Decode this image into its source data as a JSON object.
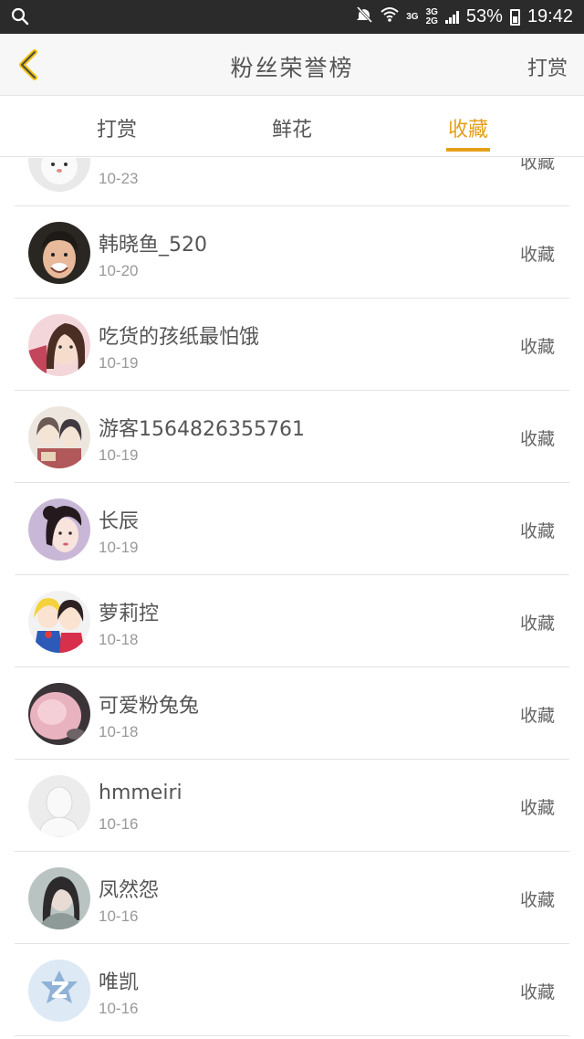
{
  "status_bar": {
    "network_top": "3G",
    "network_mid": "3G",
    "network_bottom": "2G",
    "battery": "53%",
    "time": "19:42"
  },
  "header": {
    "title": "粉丝荣誉榜",
    "action": "打赏"
  },
  "tabs": [
    {
      "label": "打赏",
      "active": false
    },
    {
      "label": "鲜花",
      "active": false
    },
    {
      "label": "收藏",
      "active": true
    }
  ],
  "accent_color": "#e5a019",
  "fans": [
    {
      "name": "",
      "date": "10-23",
      "action": "收藏",
      "avatar": "white-bunny"
    },
    {
      "name": "韩晓鱼_520",
      "date": "10-20",
      "action": "收藏",
      "avatar": "man-photo"
    },
    {
      "name": "吃货的孩纸最怕饿",
      "date": "10-19",
      "action": "收藏",
      "avatar": "girl-photo"
    },
    {
      "name": "游客1564826355761",
      "date": "10-19",
      "action": "收藏",
      "avatar": "anime-pair"
    },
    {
      "name": "长辰",
      "date": "10-19",
      "action": "收藏",
      "avatar": "painted-woman"
    },
    {
      "name": "萝莉控",
      "date": "10-18",
      "action": "收藏",
      "avatar": "anime-group"
    },
    {
      "name": "可爱粉兔兔",
      "date": "10-18",
      "action": "收藏",
      "avatar": "pink-fluff"
    },
    {
      "name": "hmmeiri",
      "date": "10-16",
      "action": "收藏",
      "avatar": "default-silhouette"
    },
    {
      "name": "凤然怨",
      "date": "10-16",
      "action": "收藏",
      "avatar": "girl-dark"
    },
    {
      "name": "唯凯",
      "date": "10-16",
      "action": "收藏",
      "avatar": "z-logo"
    }
  ]
}
